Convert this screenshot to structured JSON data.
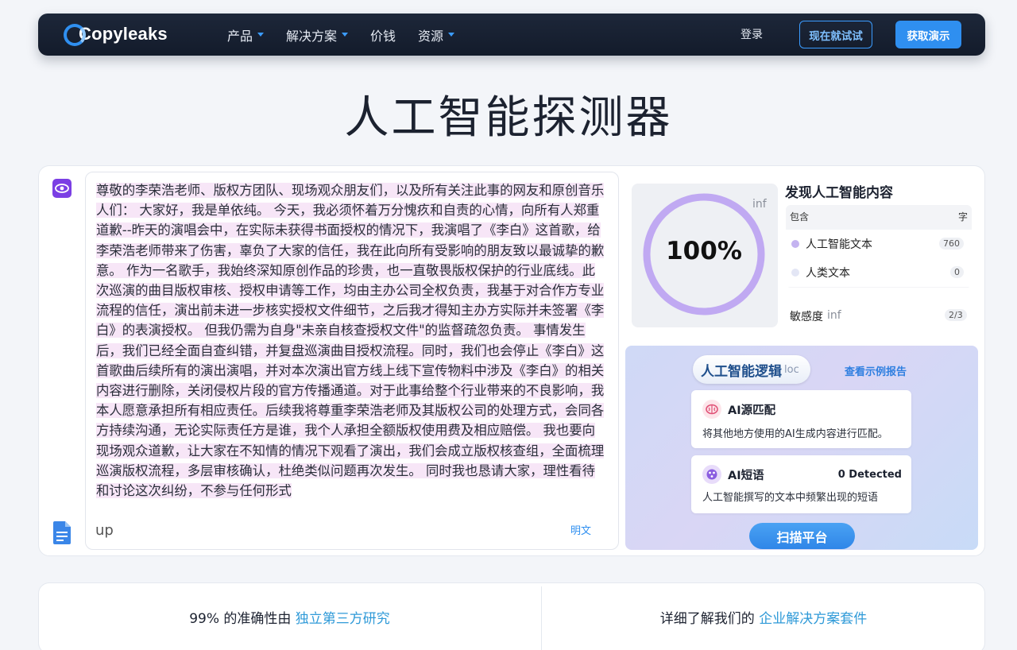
{
  "nav": {
    "logo": "Copyleaks",
    "menu": [
      "产品",
      "解决方案",
      "价钱",
      "资源"
    ],
    "login": "登录",
    "try_now": "现在就试试",
    "get_demo": "获取演示"
  },
  "page_title": "人工智能探测器",
  "editor": {
    "text": "尊敬的李荣浩老师、版权方团队、现场观众朋友们，以及所有关注此事的网友和原创音乐人们： 大家好，我是单依纯。 今天，我必须怀着万分愧疚和自责的心情，向所有人郑重道歉--昨天的演唱会中，在实际未获得书面授权的情况下，我演唱了《李白》这首歌，给李荣浩老师带来了伤害，辜负了大家的信任，我在此向所有受影响的朋友致以最诚挚的歉意。 作为一名歌手，我始终深知原创作品的珍贵，也一直敬畏版权保护的行业底线。此次巡演的曲目版权审核、授权申请等工作，均由主办公司全权负责，我基于对合作方专业流程的信任，演出前未进一步核实授权文件细节，之后我才得知主办方实际并未签署《李白》的表演授权。 但我仍需为自身\"未亲自核查授权文件\"的监督疏忽负责。 事情发生后，我们已经全面自查纠错，并复盘巡演曲目授权流程。同时，我们也会停止《李白》这首歌曲后续所有的演出演唱，并对本次演出官方线上线下宣传物料中涉及《李白》的相关内容进行删除，关闭侵权片段的官方传播通道。对于此事给整个行业带来的不良影响，我本人愿意承担所有相应责任。后续我将尊重李荣浩老师及其版权公司的处理方式，会同各方持续沟通，无论实际责任方是谁，我个人承担全额版权使用费及相应赔偿。 我也要向现场观众道歉，让大家在不知情的情况下观看了演出，我们会成立版权核查组，全面梳理巡演版权流程，多层审核确认，杜绝类似问题再次发生。 同时我也恳请大家，理性看待和讨论这次纠纷，不参与任何形式",
    "footer_left": "up",
    "footer_right": "明文"
  },
  "result": {
    "percent": "100%",
    "percent_value": 100,
    "inf": "inf",
    "title": "发现人工智能内容",
    "col_left": "包含",
    "col_right": "字",
    "rows": [
      {
        "label": "人工智能文本",
        "count": "760",
        "color": "#c4b3f0"
      },
      {
        "label": "人类文本",
        "count": "0",
        "color": "#e3e6f5"
      }
    ],
    "sensitivity_label": "敏感度",
    "sensitivity_inf": "inf",
    "sensitivity_value": "2/3"
  },
  "logic": {
    "title": "人工智能逻辑",
    "title_suffix": "loc",
    "example_link": "查看示例报告",
    "features": [
      {
        "title": "AI源匹配",
        "desc": "将其他地方使用的AI生成内容进行匹配。",
        "right": ""
      },
      {
        "title": "AI短语",
        "desc": "人工智能撰写的文本中频繁出现的短语",
        "right": "0 Detected"
      }
    ],
    "scan_button": "扫描平台"
  },
  "bottom": {
    "left_prefix": "99% 的准确性由 ",
    "left_link": "独立第三方研究",
    "right_prefix": "详细了解我们的 ",
    "right_link": "企业解决方案套件"
  },
  "colors": {
    "accent": "#2f8ff0",
    "ring": "#c0a9f2",
    "highlight": "#f7e6f7"
  }
}
